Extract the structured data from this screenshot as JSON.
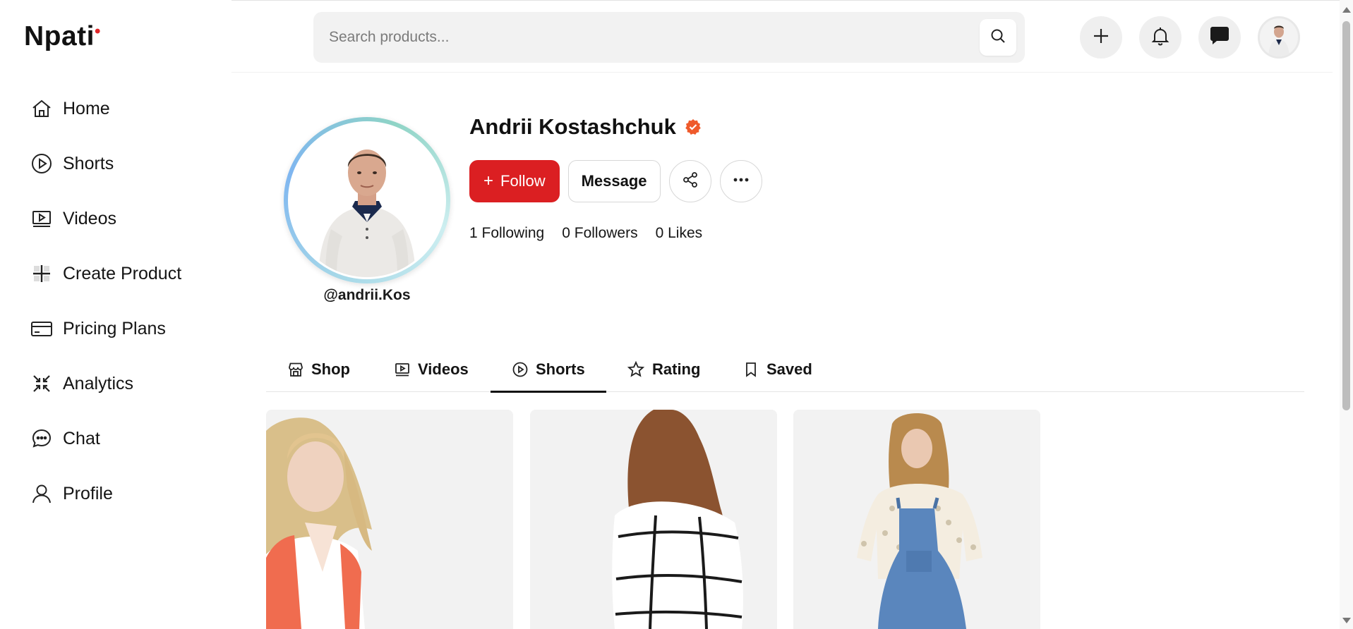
{
  "app": {
    "logo": "Npati"
  },
  "sidebar": {
    "items": [
      {
        "label": "Home",
        "icon": "home-icon"
      },
      {
        "label": "Shorts",
        "icon": "play-circle-icon"
      },
      {
        "label": "Videos",
        "icon": "video-icon"
      },
      {
        "label": "Create Product",
        "icon": "plus-grid-icon"
      },
      {
        "label": "Pricing Plans",
        "icon": "credit-card-icon"
      },
      {
        "label": "Analytics",
        "icon": "analytics-icon"
      },
      {
        "label": "Chat",
        "icon": "chat-bubble-icon"
      },
      {
        "label": "Profile",
        "icon": "user-icon"
      }
    ]
  },
  "header": {
    "search_placeholder": "Search products...",
    "buttons": [
      "plus-icon",
      "bell-icon",
      "message-icon",
      "user-avatar"
    ]
  },
  "profile": {
    "name": "Andrii Kostashchuk",
    "handle": "@andrii.Kos",
    "verified": true,
    "follow_label": "Follow",
    "message_label": "Message",
    "stats": {
      "following": "1 Following",
      "followers": "0 Followers",
      "likes": "0 Likes"
    }
  },
  "tabs": [
    {
      "label": "Shop",
      "icon": "store-icon"
    },
    {
      "label": "Videos",
      "icon": "video-icon"
    },
    {
      "label": "Shorts",
      "icon": "play-circle-icon",
      "active": true
    },
    {
      "label": "Rating",
      "icon": "star-icon"
    },
    {
      "label": "Saved",
      "icon": "bookmark-icon"
    }
  ],
  "colors": {
    "accent": "#db1f22",
    "verified": "#ef5a2b",
    "text": "#111111",
    "search_bg": "#f2f2f2"
  }
}
